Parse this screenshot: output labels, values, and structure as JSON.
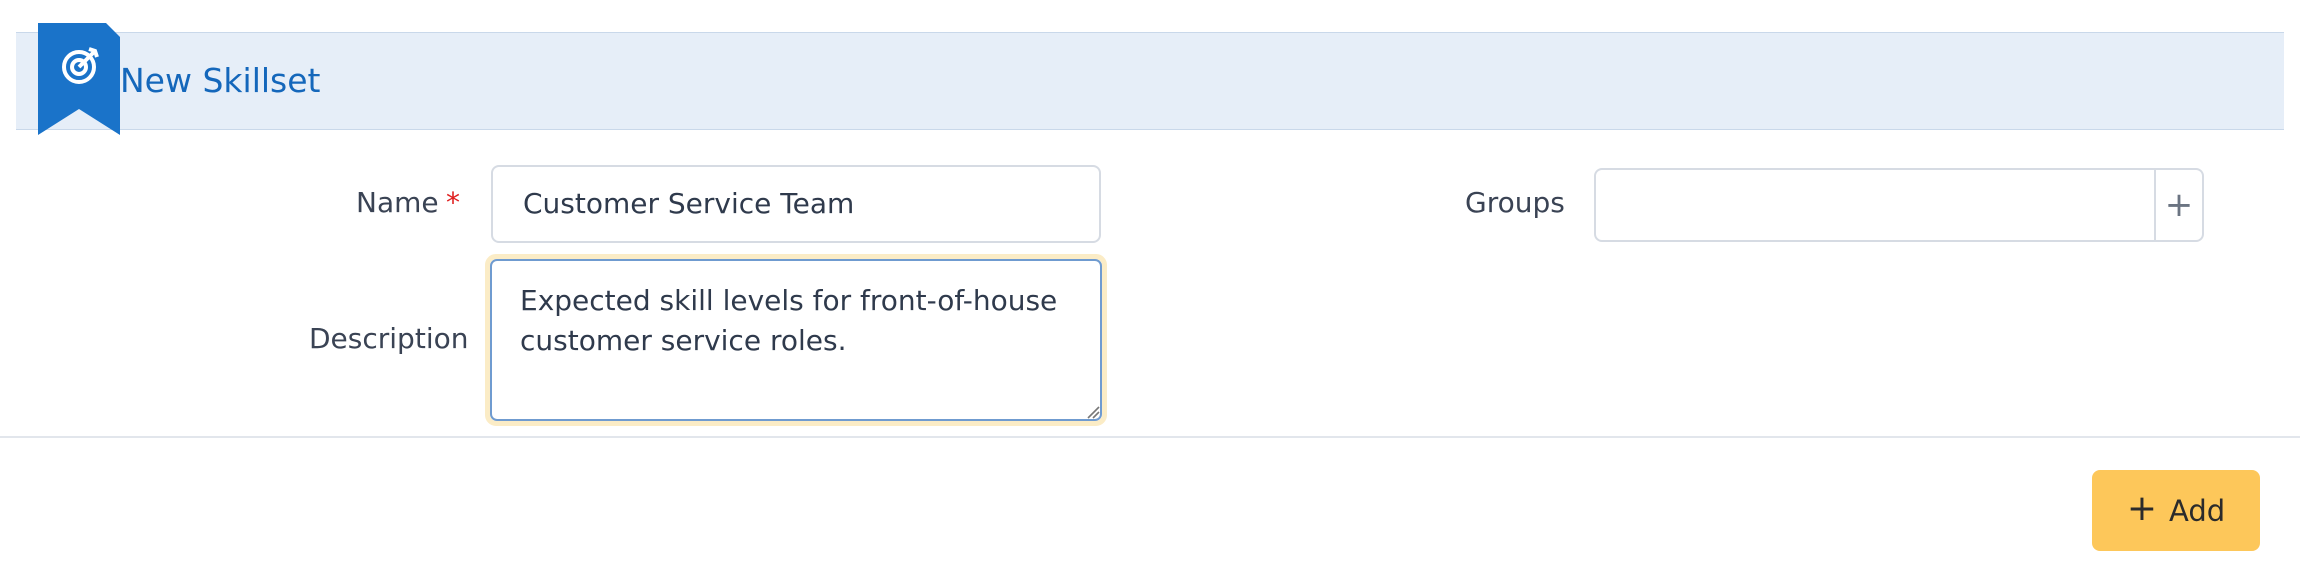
{
  "header": {
    "title": "New Skillset",
    "icon": "target-icon",
    "accent_color": "#1467bb",
    "band_color": "#e6eef8"
  },
  "form": {
    "name": {
      "label": "Name",
      "required_marker": "*",
      "value": "Customer Service Team"
    },
    "description": {
      "label": "Description",
      "value": "Expected skill levels for front-of-house customer service roles."
    },
    "groups": {
      "label": "Groups",
      "value": "",
      "add_icon": "plus-icon",
      "add_symbol": "+"
    }
  },
  "footer": {
    "add_button": {
      "label": "Add",
      "icon_symbol": "+",
      "color": "#fdc75a"
    }
  }
}
